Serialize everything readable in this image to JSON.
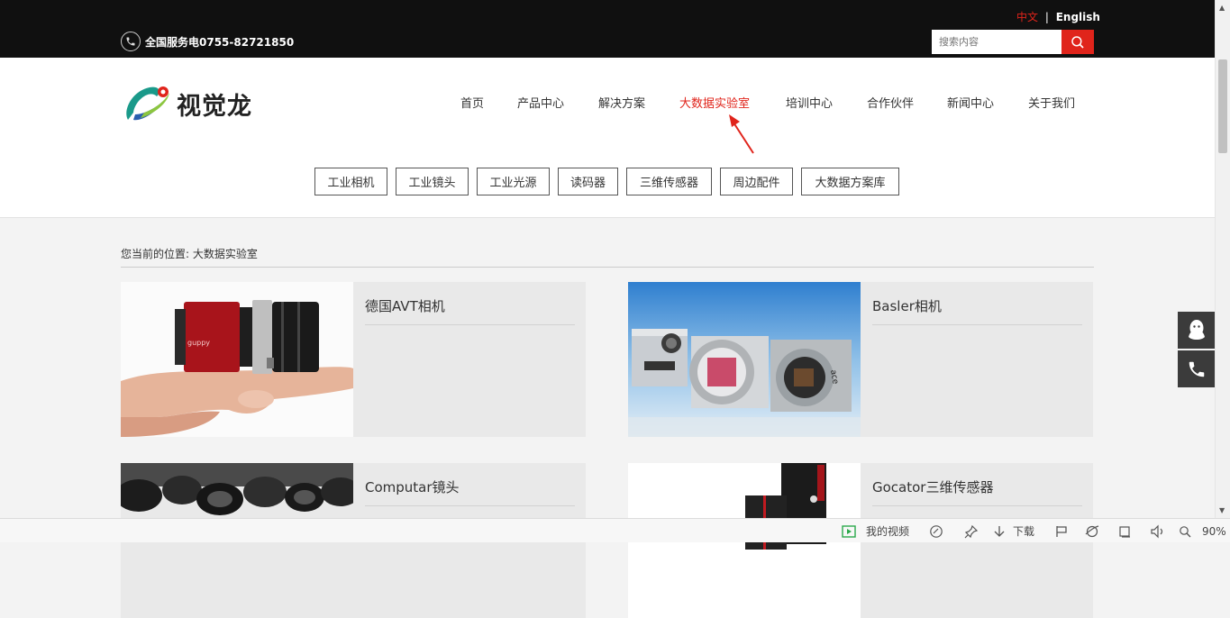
{
  "topbar": {
    "hotline": "全国服务电0755-82721850",
    "lang_cn": "中文",
    "lang_sep": "|",
    "lang_en": "English",
    "search_placeholder": "搜索内容"
  },
  "brand": {
    "name": "视觉龙",
    "accent": "#e0241b"
  },
  "nav": [
    {
      "label": "首页",
      "active": false
    },
    {
      "label": "产品中心",
      "active": false
    },
    {
      "label": "解决方案",
      "active": false
    },
    {
      "label": "大数据实验室",
      "active": true
    },
    {
      "label": "培训中心",
      "active": false
    },
    {
      "label": "合作伙伴",
      "active": false
    },
    {
      "label": "新闻中心",
      "active": false
    },
    {
      "label": "关于我们",
      "active": false
    }
  ],
  "subnav": [
    "工业相机",
    "工业镜头",
    "工业光源",
    "读码器",
    "三维传感器",
    "周边配件",
    "大数据方案库"
  ],
  "breadcrumb": {
    "prefix": "您当前的位置:",
    "current": "大数据实验室"
  },
  "products": [
    {
      "title": "德国AVT相机"
    },
    {
      "title": "Basler相机"
    },
    {
      "title": "Computar镜头"
    },
    {
      "title": "Gocator三维传感器"
    }
  ],
  "side_buttons": [
    "qq-icon",
    "phone-icon"
  ],
  "statusbar": {
    "video": "我的视频",
    "download": "下载",
    "zoom": "90%"
  }
}
